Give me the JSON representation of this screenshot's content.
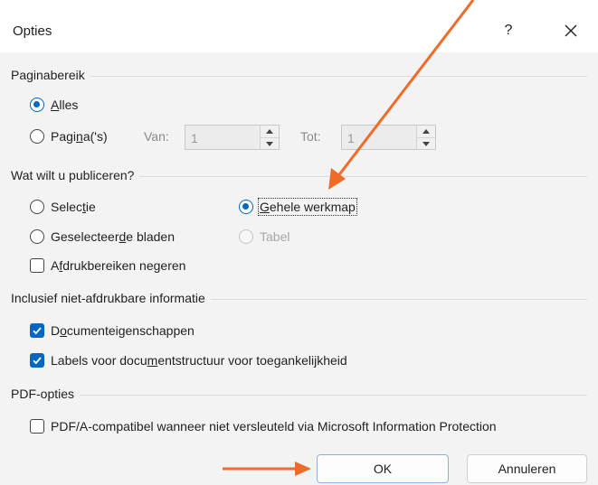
{
  "dialog": {
    "title": "Opties",
    "help_symbol": "?"
  },
  "page_range": {
    "group_label": "Paginabereik",
    "all": {
      "pre": "",
      "u": "A",
      "post": "lles",
      "selected": true
    },
    "pages": {
      "pre": "Pagi",
      "u": "n",
      "post": "a('s)",
      "selected": false
    },
    "from_label": "Van:",
    "from_value": "1",
    "to_label": "Tot:",
    "to_value": "1"
  },
  "publish": {
    "group_label": "Wat wilt u publiceren?",
    "selection": {
      "pre": "Selec",
      "u": "t",
      "post": "ie",
      "selected": false
    },
    "whole_workbook": {
      "pre": "",
      "u": "G",
      "post": "ehele werkmap",
      "selected": true
    },
    "selected_sheets": {
      "pre": "Geselecteer",
      "u": "d",
      "post": "e bladen",
      "selected": false
    },
    "table": {
      "label": "Tabel",
      "enabled": false
    },
    "ignore_print_areas": {
      "pre": "A",
      "u": "f",
      "post": "drukbereiken negeren",
      "checked": false
    }
  },
  "non_print_info": {
    "group_label": "Inclusief niet-afdrukbare informatie",
    "doc_properties": {
      "pre": "D",
      "u": "o",
      "post": "cumenteigenschappen",
      "checked": true
    },
    "structure_tags": {
      "pre": "Labels voor docu",
      "u": "m",
      "post": "entstructuur voor toegankelijkheid",
      "checked": true
    }
  },
  "pdf_options": {
    "group_label": "PDF-opties",
    "pdfa": {
      "label": "PDF/A-compatibel wanneer niet versleuteld via Microsoft Information Protection",
      "checked": false
    }
  },
  "buttons": {
    "ok": "OK",
    "cancel": "Annuleren"
  },
  "colors": {
    "accent": "#0067c0",
    "annotation_arrow": "#f06a28",
    "dialog_bg": "#f3f3f3"
  }
}
